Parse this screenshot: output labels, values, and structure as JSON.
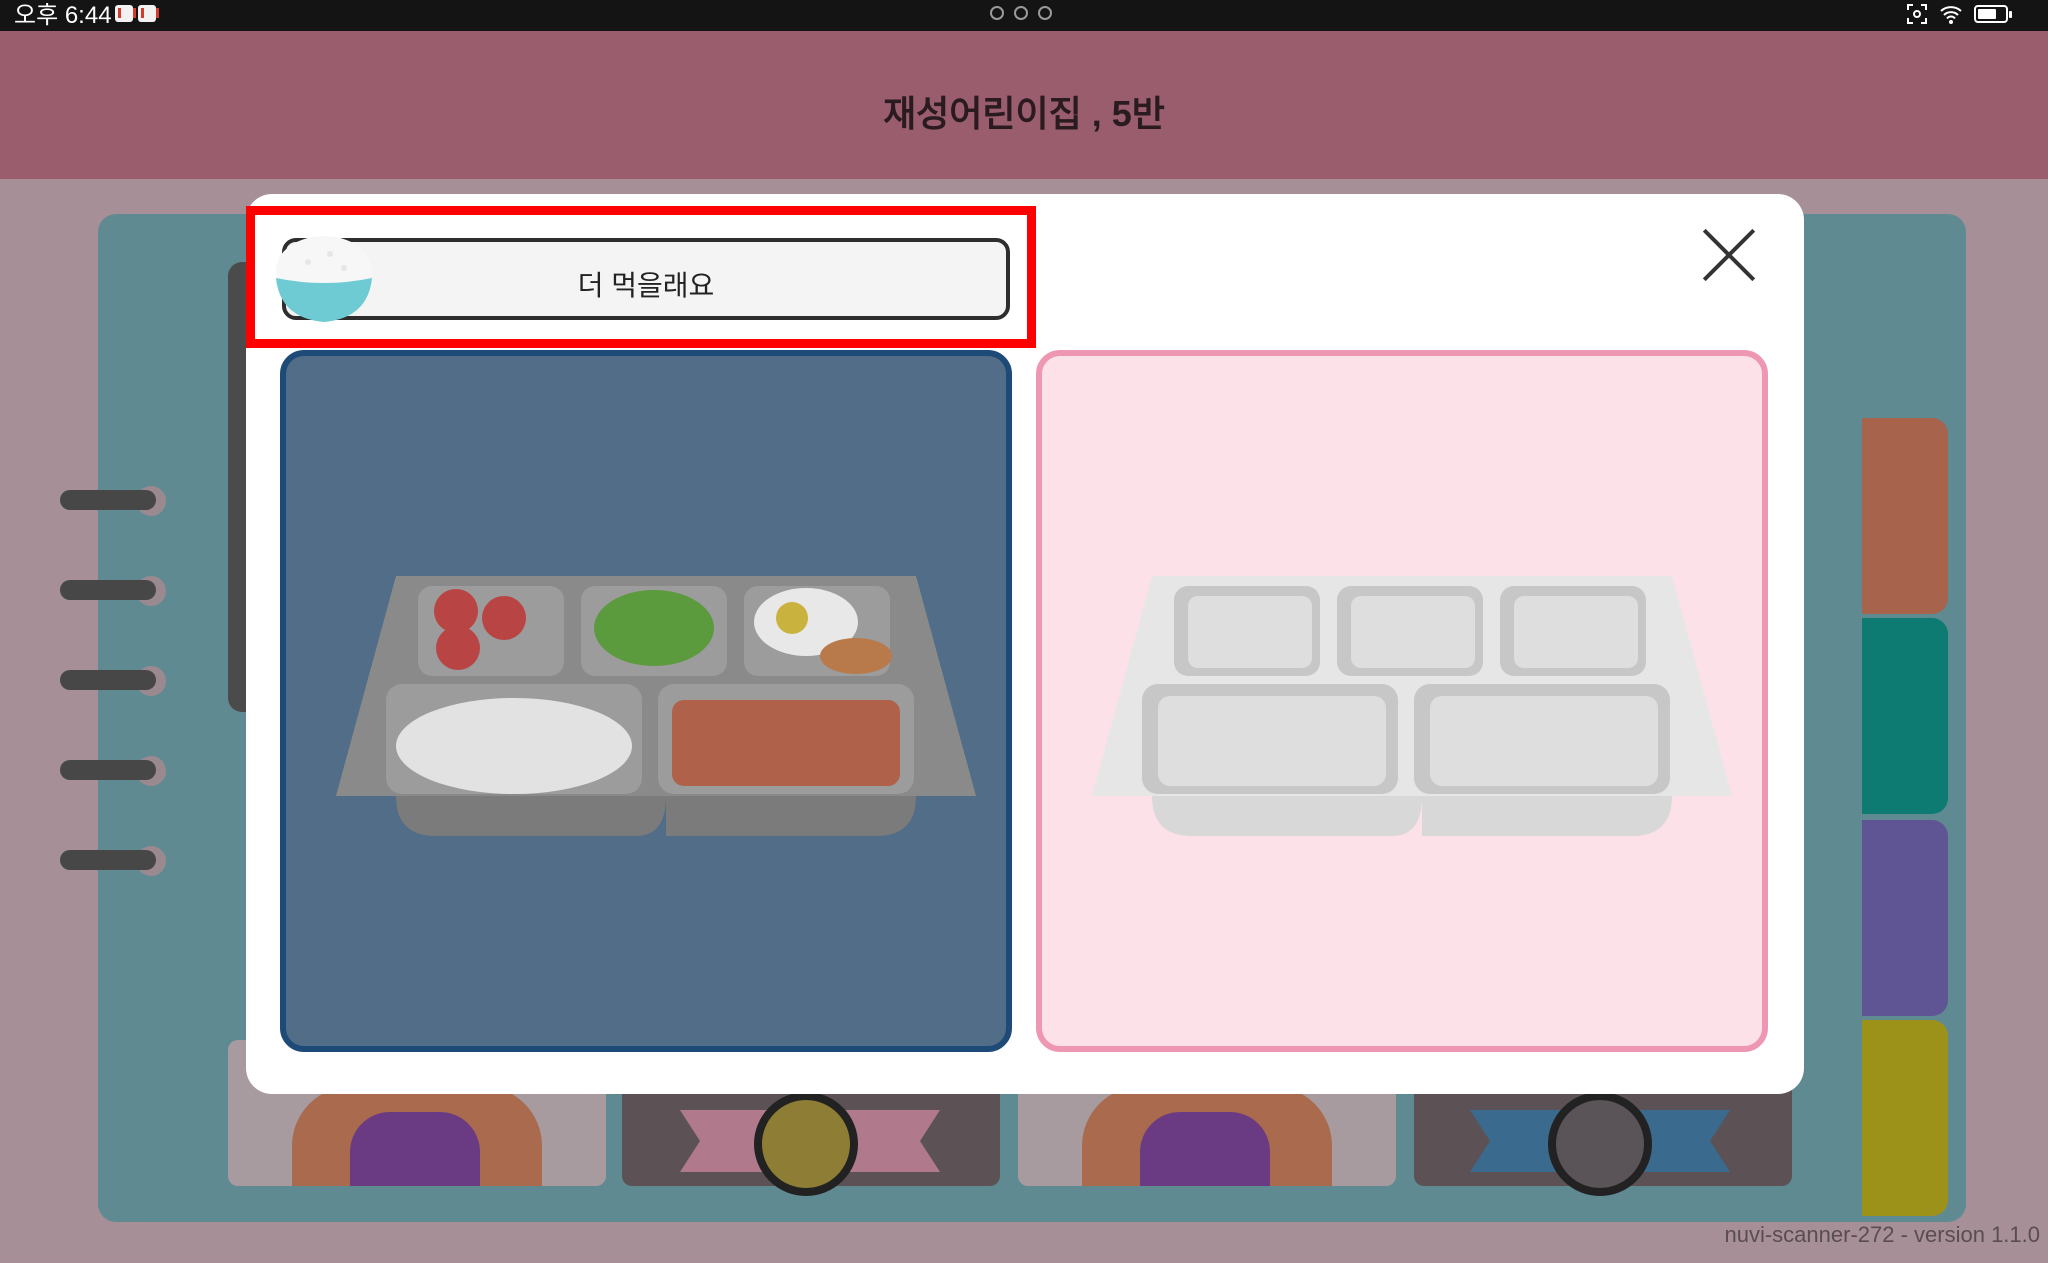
{
  "status_bar": {
    "time": "오후 6:44",
    "notification_icons": [
      "gmail-icon",
      "gmail-icon"
    ],
    "right_icons": [
      "screenshot-icon",
      "wifi-icon",
      "battery-icon"
    ]
  },
  "header": {
    "title": "재성어린이집 , 5반"
  },
  "modal": {
    "option_label": "더 먹을래요",
    "close_icon": "close-icon",
    "choices": [
      {
        "name": "full-tray",
        "selected": true,
        "color": "#516d87"
      },
      {
        "name": "empty-tray",
        "selected": false,
        "color": "#fde1e8"
      }
    ]
  },
  "background_tabs": [
    "#a8634c",
    "#0d7b72",
    "#5f5494",
    "#9c921a"
  ],
  "footer": {
    "version": "nuvi-scanner-272 - version 1.1.0"
  }
}
